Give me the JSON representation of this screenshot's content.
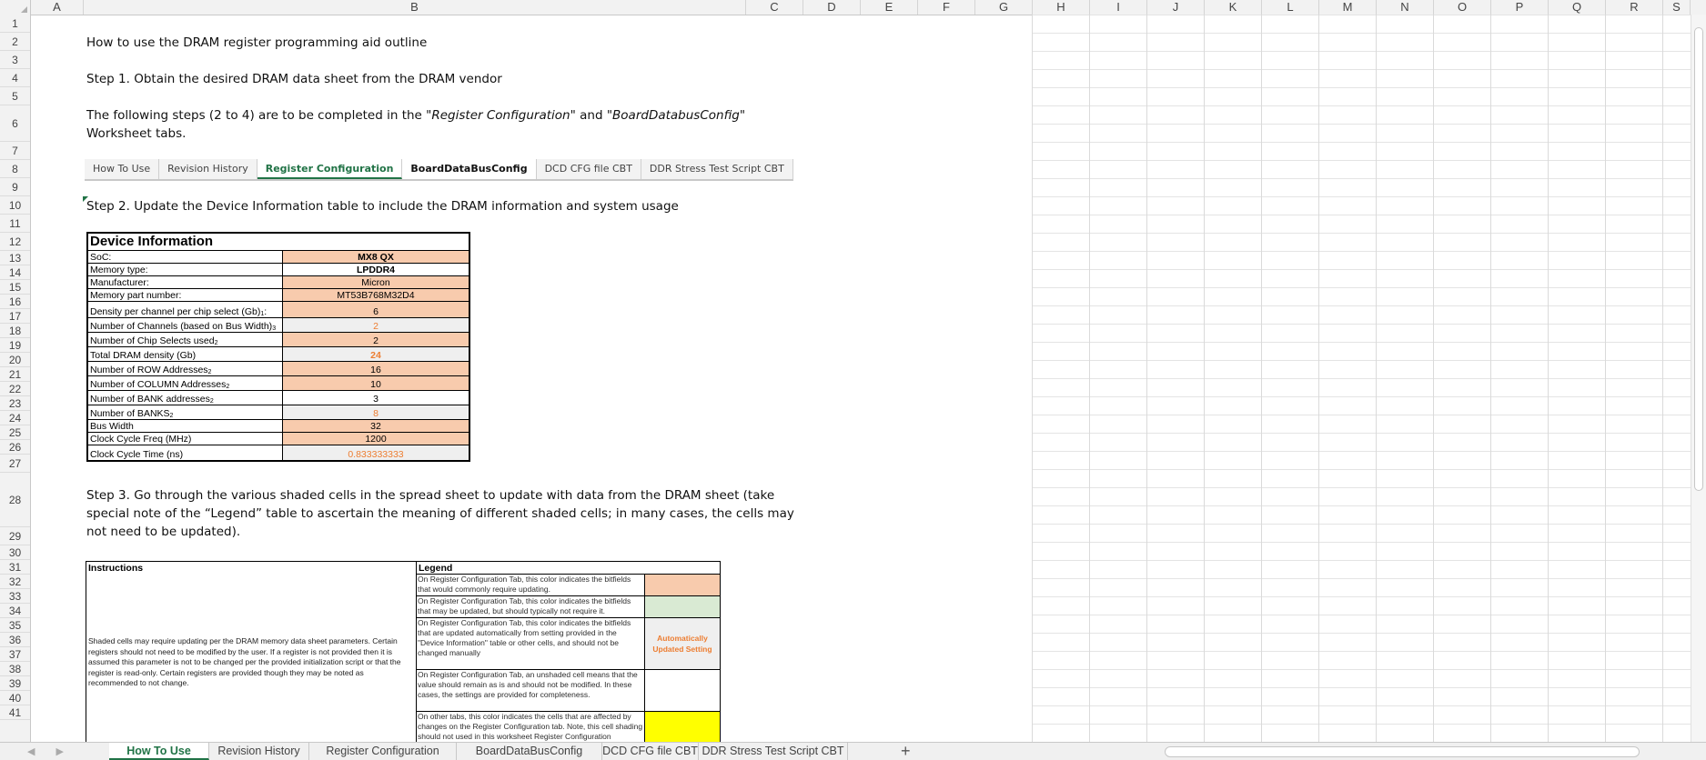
{
  "columns": [
    {
      "label": "A",
      "w": 58
    },
    {
      "label": "B",
      "w": 728
    },
    {
      "label": "C",
      "w": 63
    },
    {
      "label": "D",
      "w": 63
    },
    {
      "label": "E",
      "w": 63
    },
    {
      "label": "F",
      "w": 63
    },
    {
      "label": "G",
      "w": 63
    },
    {
      "label": "H",
      "w": 63
    },
    {
      "label": "I",
      "w": 63
    },
    {
      "label": "J",
      "w": 63
    },
    {
      "label": "K",
      "w": 63
    },
    {
      "label": "L",
      "w": 63
    },
    {
      "label": "M",
      "w": 63
    },
    {
      "label": "N",
      "w": 63
    },
    {
      "label": "O",
      "w": 63
    },
    {
      "label": "P",
      "w": 63
    },
    {
      "label": "Q",
      "w": 63
    },
    {
      "label": "R",
      "w": 63
    },
    {
      "label": "S",
      "w": 30
    }
  ],
  "rows": [
    "1",
    "2",
    "3",
    "4",
    "5",
    "6",
    "7",
    "8",
    "9",
    "10",
    "11",
    "12",
    "13",
    "14",
    "15",
    "16",
    "17",
    "18",
    "19",
    "20",
    "21",
    "22",
    "23",
    "24",
    "25",
    "26",
    "27",
    "28",
    "29",
    "30",
    "31",
    "32",
    "33",
    "34",
    "35",
    "36",
    "37",
    "38",
    "39",
    "40",
    "41"
  ],
  "texts": {
    "title": "How to use the DRAM register programming aid outline",
    "step1": "Step 1. Obtain the desired DRAM data sheet from the DRAM vendor",
    "step_intro_a": "The following steps (2 to 4) are to be completed in the \"",
    "step_intro_i1": "Register Configuration",
    "step_intro_b": "\" and \"",
    "step_intro_i2": "BoardDatabusConfig",
    "step_intro_c": "\"",
    "step_intro_line2": "Worksheet tabs.",
    "step2": "Step 2. Update the Device Information table to include the DRAM information and system usage",
    "step3_l1": "Step 3. Go through the various shaded cells in the spread sheet to update with data from the DRAM sheet (take",
    "step3_l2": "special note of the “Legend” table to ascertain the meaning of different shaded cells; in many cases, the cells may",
    "step3_l3": "not need to be updated)."
  },
  "inline_tabs": [
    {
      "label": "How To Use",
      "style": ""
    },
    {
      "label": "Revision History",
      "style": ""
    },
    {
      "label": "Register Configuration",
      "style": "active"
    },
    {
      "label": "BoardDataBusConfig",
      "style": "bold"
    },
    {
      "label": "DCD CFG file CBT",
      "style": ""
    },
    {
      "label": "DDR Stress Test Script CBT",
      "style": ""
    }
  ],
  "device_info": {
    "title": "Device Information",
    "rows": [
      {
        "label": "SoC:",
        "sup": "",
        "value": "MX8 QX",
        "fill": "orange",
        "bold": true,
        "auto": false
      },
      {
        "label": "Memory type:",
        "sup": "",
        "value": "LPDDR4",
        "fill": "",
        "bold": true,
        "auto": false
      },
      {
        "label": "Manufacturer:",
        "sup": "",
        "value": "Micron",
        "fill": "orange",
        "bold": false,
        "auto": false
      },
      {
        "label": "Memory part number:",
        "sup": "",
        "value": "MT53B768M32D4",
        "fill": "orange",
        "bold": false,
        "auto": false
      },
      {
        "label": "Density per channel per chip select (Gb)",
        "sup": "1",
        "suffix": ":",
        "value": "6",
        "fill": "orange",
        "bold": false,
        "auto": false
      },
      {
        "label": "Number of Channels (based on Bus Width)",
        "sup": "3",
        "value": "2",
        "fill": "grey",
        "bold": false,
        "auto": true
      },
      {
        "label": "Number of Chip Selects used",
        "sup": "2",
        "value": "2",
        "fill": "orange",
        "bold": false,
        "auto": false
      },
      {
        "label": "Total DRAM density (Gb)",
        "sup": "",
        "value": "24",
        "fill": "grey",
        "bold": true,
        "auto": true
      },
      {
        "label": "Number of ROW Addresses",
        "sup": "2",
        "value": "16",
        "fill": "orange",
        "bold": false,
        "auto": false
      },
      {
        "label": "Number of COLUMN Addresses",
        "sup": "2",
        "value": "10",
        "fill": "orange",
        "bold": false,
        "auto": false
      },
      {
        "label": "Number of BANK addresses",
        "sup": "2",
        "value": "3",
        "fill": "",
        "bold": false,
        "auto": false
      },
      {
        "label": "Number of BANKS",
        "sup": "2",
        "value": "8",
        "fill": "grey",
        "bold": false,
        "auto": true
      },
      {
        "label": "Bus Width",
        "sup": "",
        "value": "32",
        "fill": "orange",
        "bold": false,
        "auto": false
      },
      {
        "label": "Clock Cycle Freq (MHz)",
        "sup": "",
        "value": "1200",
        "fill": "orange",
        "bold": false,
        "auto": false
      },
      {
        "label": "Clock Cycle Time (ns)",
        "sup": "",
        "value": "0.833333333",
        "fill": "grey",
        "bold": false,
        "auto": true
      }
    ]
  },
  "instructions": {
    "header": "Instructions",
    "body": "Shaded cells may require updating per the DRAM memory data sheet parameters. Certain registers should not need to be modified by the user. If a register is not provided then it is assumed this parameter is not to be changed per the provided initialization script or that the register is read-only. Certain registers are provided though they may be noted as recommended to not change."
  },
  "legend": {
    "header": "Legend",
    "rows": [
      {
        "text": "On Register Configuration Tab, this color indicates the bitfields that would commonly require updating.",
        "swatch": "#f8cbad",
        "label": ""
      },
      {
        "text": "On Register Configuration Tab, this color indicates the bitfields that may be updated, but should typically not require it.",
        "swatch": "#d9ead3",
        "label": ""
      },
      {
        "text": "On Register Configuration Tab, this color indicates the bitfields that are updated automatically from setting provided in the \"Device Information\" table or other cells, and should not be changed manually",
        "swatch": "#efefef",
        "label": "Automatically Updated Setting"
      },
      {
        "text": "On Register Configuration Tab, an unshaded cell means that the value should remain as is and should not be modified. In these cases, the settings are provided for completeness.",
        "swatch": "#ffffff",
        "label": ""
      },
      {
        "text": "On other tabs, this color indicates the cells that are affected by changes on the Register Configuration tab. Note, this cell shading should not used in this worksheet Register Configuration",
        "swatch": "#ffff00",
        "label": ""
      }
    ]
  },
  "sheet_tabs": [
    {
      "label": "How To Use",
      "active": true
    },
    {
      "label": "Revision History",
      "active": false
    },
    {
      "label": "Register Configuration",
      "active": false
    },
    {
      "label": "BoardDataBusConfig",
      "active": false
    },
    {
      "label": "DCD CFG file CBT",
      "active": false
    },
    {
      "label": "DDR Stress Test Script CBT",
      "active": false
    }
  ],
  "icons": {
    "add_sheet": "+",
    "nav": "◀ ▶"
  }
}
